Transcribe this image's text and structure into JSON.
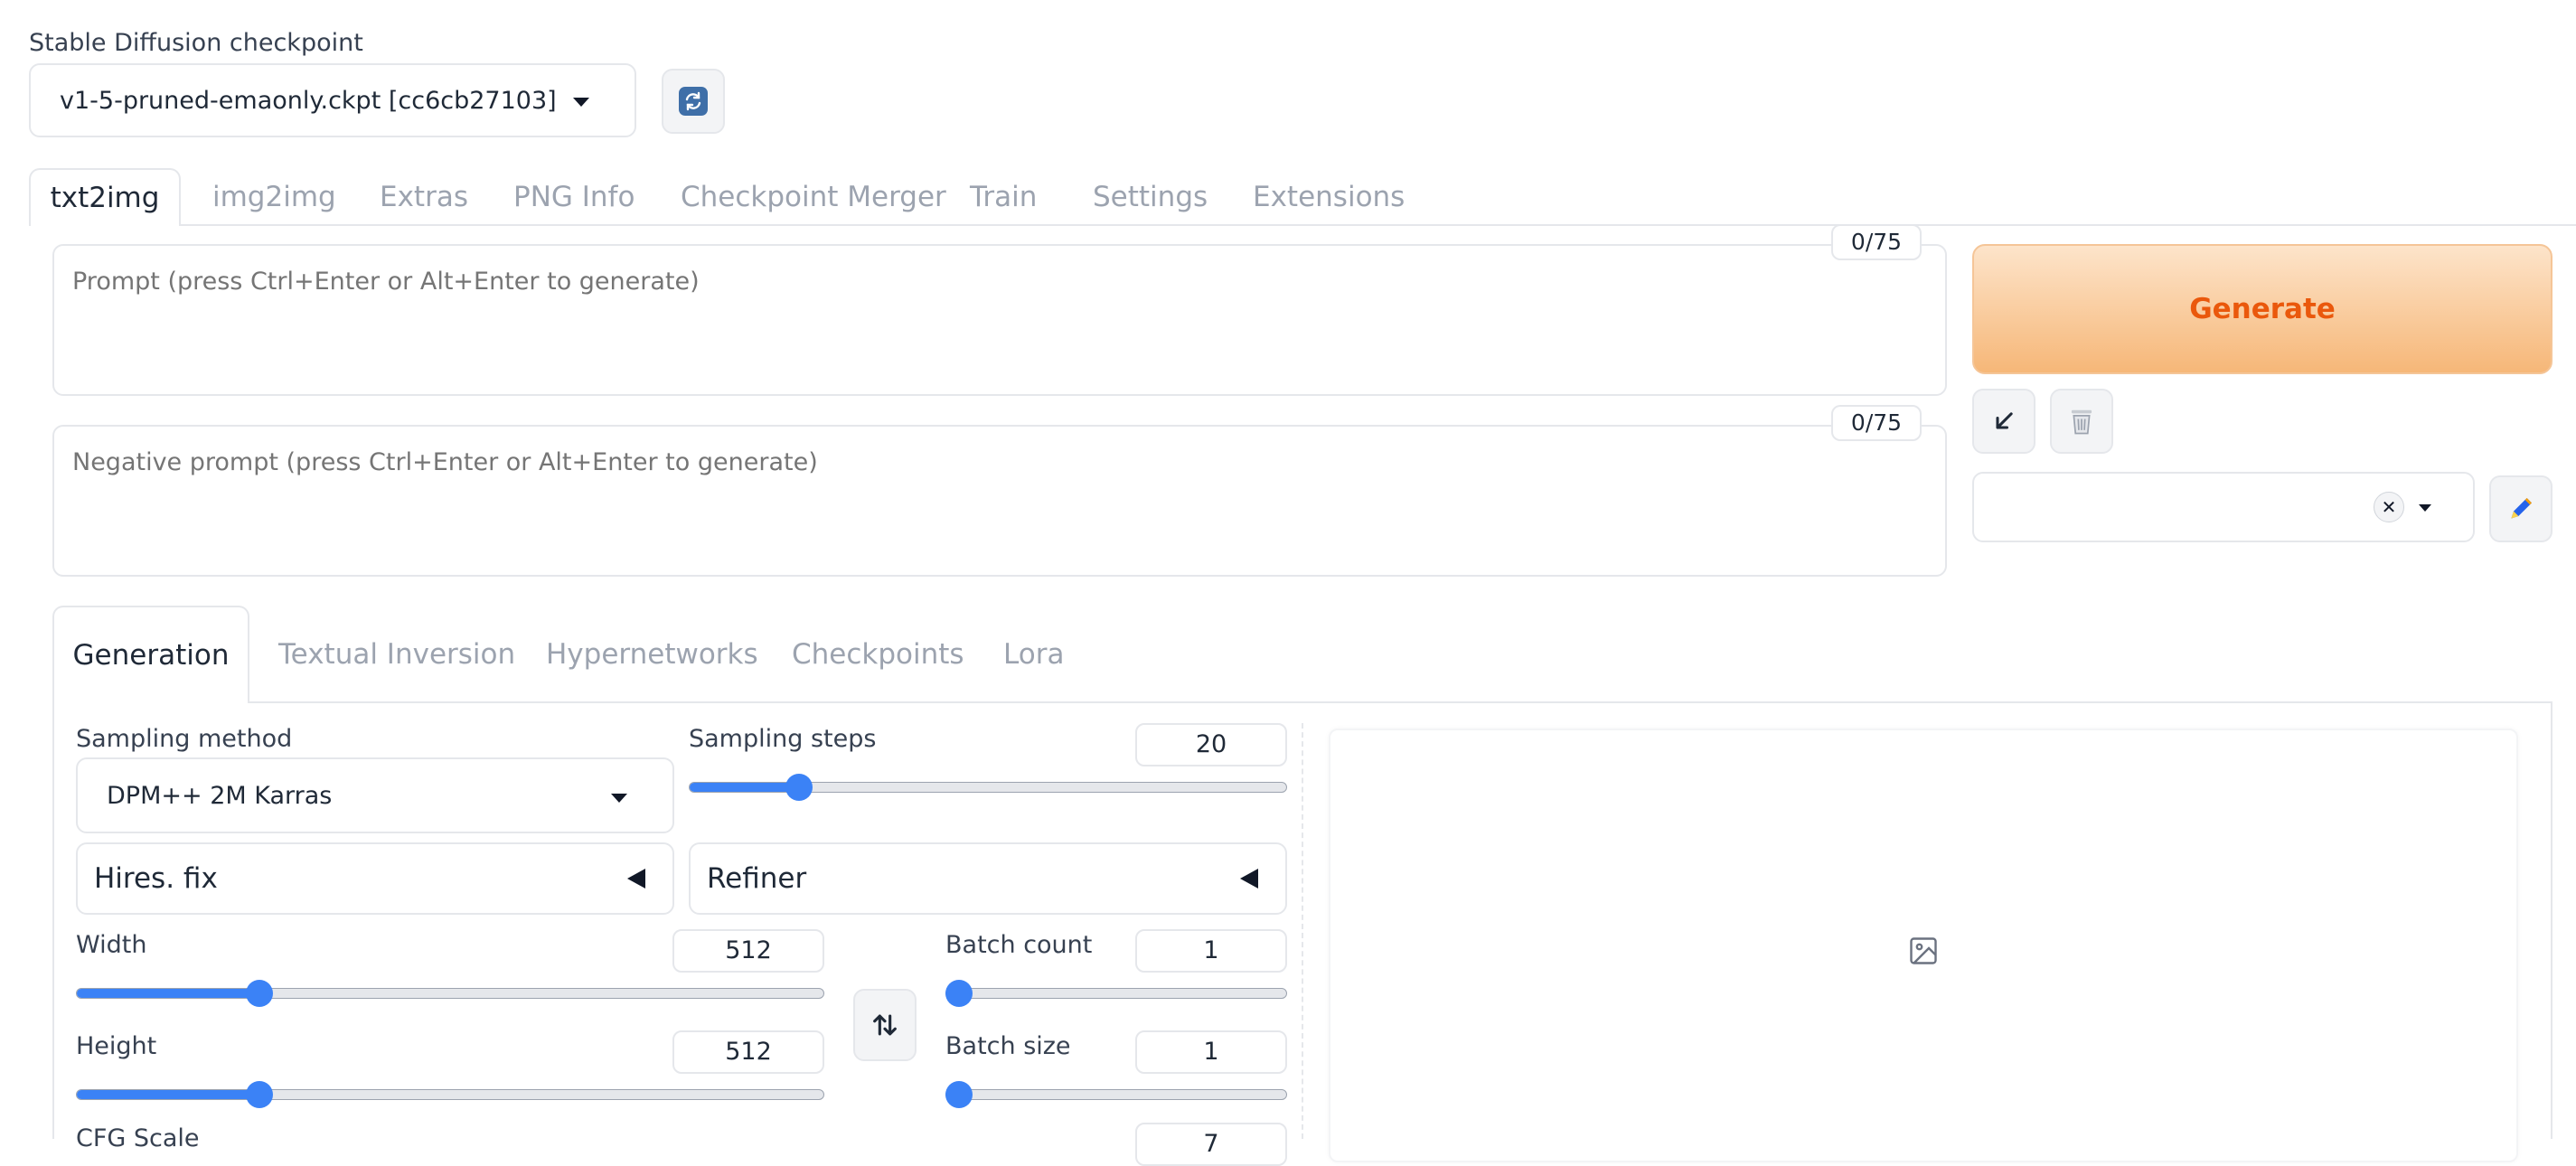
{
  "checkpoint": {
    "label": "Stable Diffusion checkpoint",
    "value": "v1-5-pruned-emaonly.ckpt [cc6cb27103]",
    "refresh_icon": "refresh-icon"
  },
  "main_tabs": [
    {
      "label": "txt2img",
      "active": true
    },
    {
      "label": "img2img"
    },
    {
      "label": "Extras"
    },
    {
      "label": "PNG Info"
    },
    {
      "label": "Checkpoint Merger"
    },
    {
      "label": "Train"
    },
    {
      "label": "Settings"
    },
    {
      "label": "Extensions"
    }
  ],
  "prompt": {
    "placeholder": "Prompt (press Ctrl+Enter or Alt+Enter to generate)",
    "value": "",
    "counter": "0/75"
  },
  "negative_prompt": {
    "placeholder": "Negative prompt (press Ctrl+Enter or Alt+Enter to generate)",
    "value": "",
    "counter": "0/75"
  },
  "actions": {
    "generate_label": "Generate",
    "read_params_icon": "arrow-down-left-icon",
    "clear_icon": "trash-icon",
    "style_clear_icon": "close-icon",
    "style_edit_icon": "pencil-icon",
    "styles_value": ""
  },
  "sub_tabs": [
    {
      "label": "Generation",
      "active": true
    },
    {
      "label": "Textual Inversion"
    },
    {
      "label": "Hypernetworks"
    },
    {
      "label": "Checkpoints"
    },
    {
      "label": "Lora"
    }
  ],
  "generation": {
    "sampling_method_label": "Sampling method",
    "sampling_method_value": "DPM++ 2M Karras",
    "sampling_steps_label": "Sampling steps",
    "sampling_steps_value": "20",
    "sampling_steps_fraction": 0.17,
    "hires_label": "Hires. fix",
    "refiner_label": "Refiner",
    "width_label": "Width",
    "width_value": "512",
    "width_fraction": 0.235,
    "height_label": "Height",
    "height_value": "512",
    "height_fraction": 0.235,
    "swap_icon": "swap-vertical-icon",
    "batch_count_label": "Batch count",
    "batch_count_value": "1",
    "batch_count_fraction": 0.0,
    "batch_size_label": "Batch size",
    "batch_size_value": "1",
    "batch_size_fraction": 0.0,
    "cfg_label": "CFG Scale",
    "cfg_value": "7"
  },
  "output": {
    "image_icon": "image-placeholder-icon"
  },
  "colors": {
    "accent": "#3b82f6",
    "generate_text": "#ea580c",
    "generate_bg_from": "#fde1c4",
    "generate_bg_to": "#f5b471"
  }
}
